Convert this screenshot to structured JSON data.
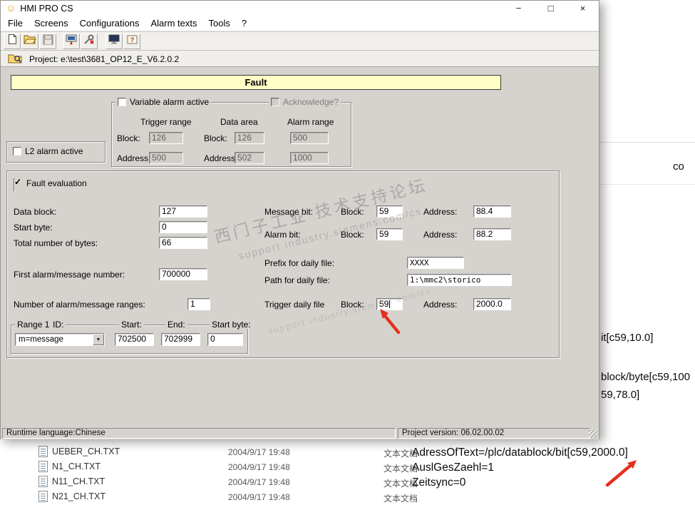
{
  "icons": {
    "app_smiley": "☺",
    "minimize": "−",
    "maximize": "□",
    "close": "×",
    "dropdown_arrow": "▼",
    "toolbar": [
      "new-document",
      "open-folder",
      "save",
      "download",
      "settings",
      "screen",
      "help"
    ]
  },
  "titlebar": {
    "title": "HMI PRO CS"
  },
  "menu": [
    "File",
    "Screens",
    "Configurations",
    "Alarm texts",
    "Tools",
    "?"
  ],
  "project_bar": {
    "label": "Project: e:\\test\\3681_OP12_E_V6.2.0.2"
  },
  "fault": {
    "banner": "Fault",
    "variable_alarm": {
      "label": "Variable alarm active",
      "acknowledge_label": "Acknowledge?",
      "columns": {
        "trigger": "Trigger range",
        "data": "Data area",
        "alarm": "Alarm range"
      },
      "block_label": "Block:",
      "address_label": "Address:",
      "trigger_block": "126",
      "trigger_address": "500",
      "data_block": "126",
      "data_address": "502",
      "alarm_upper": "500",
      "alarm_lower": "1000"
    },
    "l2_alarm_label": "L2 alarm active",
    "evaluation": {
      "label": "Fault evaluation",
      "data_block_label": "Data block:",
      "data_block": "127",
      "start_byte_label": "Start byte:",
      "start_byte": "0",
      "total_bytes_label": "Total number of bytes:",
      "total_bytes": "66",
      "first_alarm_label": "First alarm/message number:",
      "first_alarm": "700000",
      "ranges_label": "Number of alarm/message ranges:",
      "ranges": "1",
      "message_bit_label": "Message bit:",
      "alarm_bit_label": "Alarm bit:",
      "block_label": "Block:",
      "address_label": "Address:",
      "message_block": "59",
      "message_address": "88.4",
      "alarm_block": "59",
      "alarm_address": "88.2",
      "prefix_label": "Prefix for daily file:",
      "prefix": "XXXX",
      "path_label": "Path for daily file:",
      "path": "1:\\mmc2\\storico",
      "trigger_label": "Trigger daily file",
      "trigger_block": "59",
      "trigger_address": "2000.0"
    },
    "range1": {
      "label": "Range 1",
      "id_label": "ID:",
      "id_value": "m=message",
      "start_label": "Start:",
      "start": "702500",
      "end_label": "End:",
      "end": "702999",
      "start_byte_label": "Start byte:",
      "start_byte": "0"
    }
  },
  "statusbar": {
    "left": "Runtime language:Chinese",
    "right": "Project version: 06.02.00.02"
  },
  "background": {
    "fragment_co": "co",
    "fragment_bit": "it[c59,10.0]",
    "fragment_block": "block/byte[c59,100",
    "fragment_78": "59,78.0]",
    "files": [
      {
        "name": "UEBER_CH.TXT",
        "date": "2004/9/17 19:48",
        "type": "文本文档"
      },
      {
        "name": "N1_CH.TXT",
        "date": "2004/9/17 19:48",
        "type": "文本文档"
      },
      {
        "name": "N11_CH.TXT",
        "date": "2004/9/17 19:48",
        "type": "文本文档"
      },
      {
        "name": "N21_CH.TXT",
        "date": "2004/9/17 19:48",
        "type": "文本文档"
      }
    ],
    "ini_lines": [
      "AdressOfText=/plc/datablock/bit[c59,2000.0]",
      "AuslGesZaehl=1",
      "Zeitsync=0"
    ]
  },
  "watermark": {
    "line1": "西门子工业 技术支持论坛",
    "line2": "support.industry.siemens.com/cs"
  }
}
